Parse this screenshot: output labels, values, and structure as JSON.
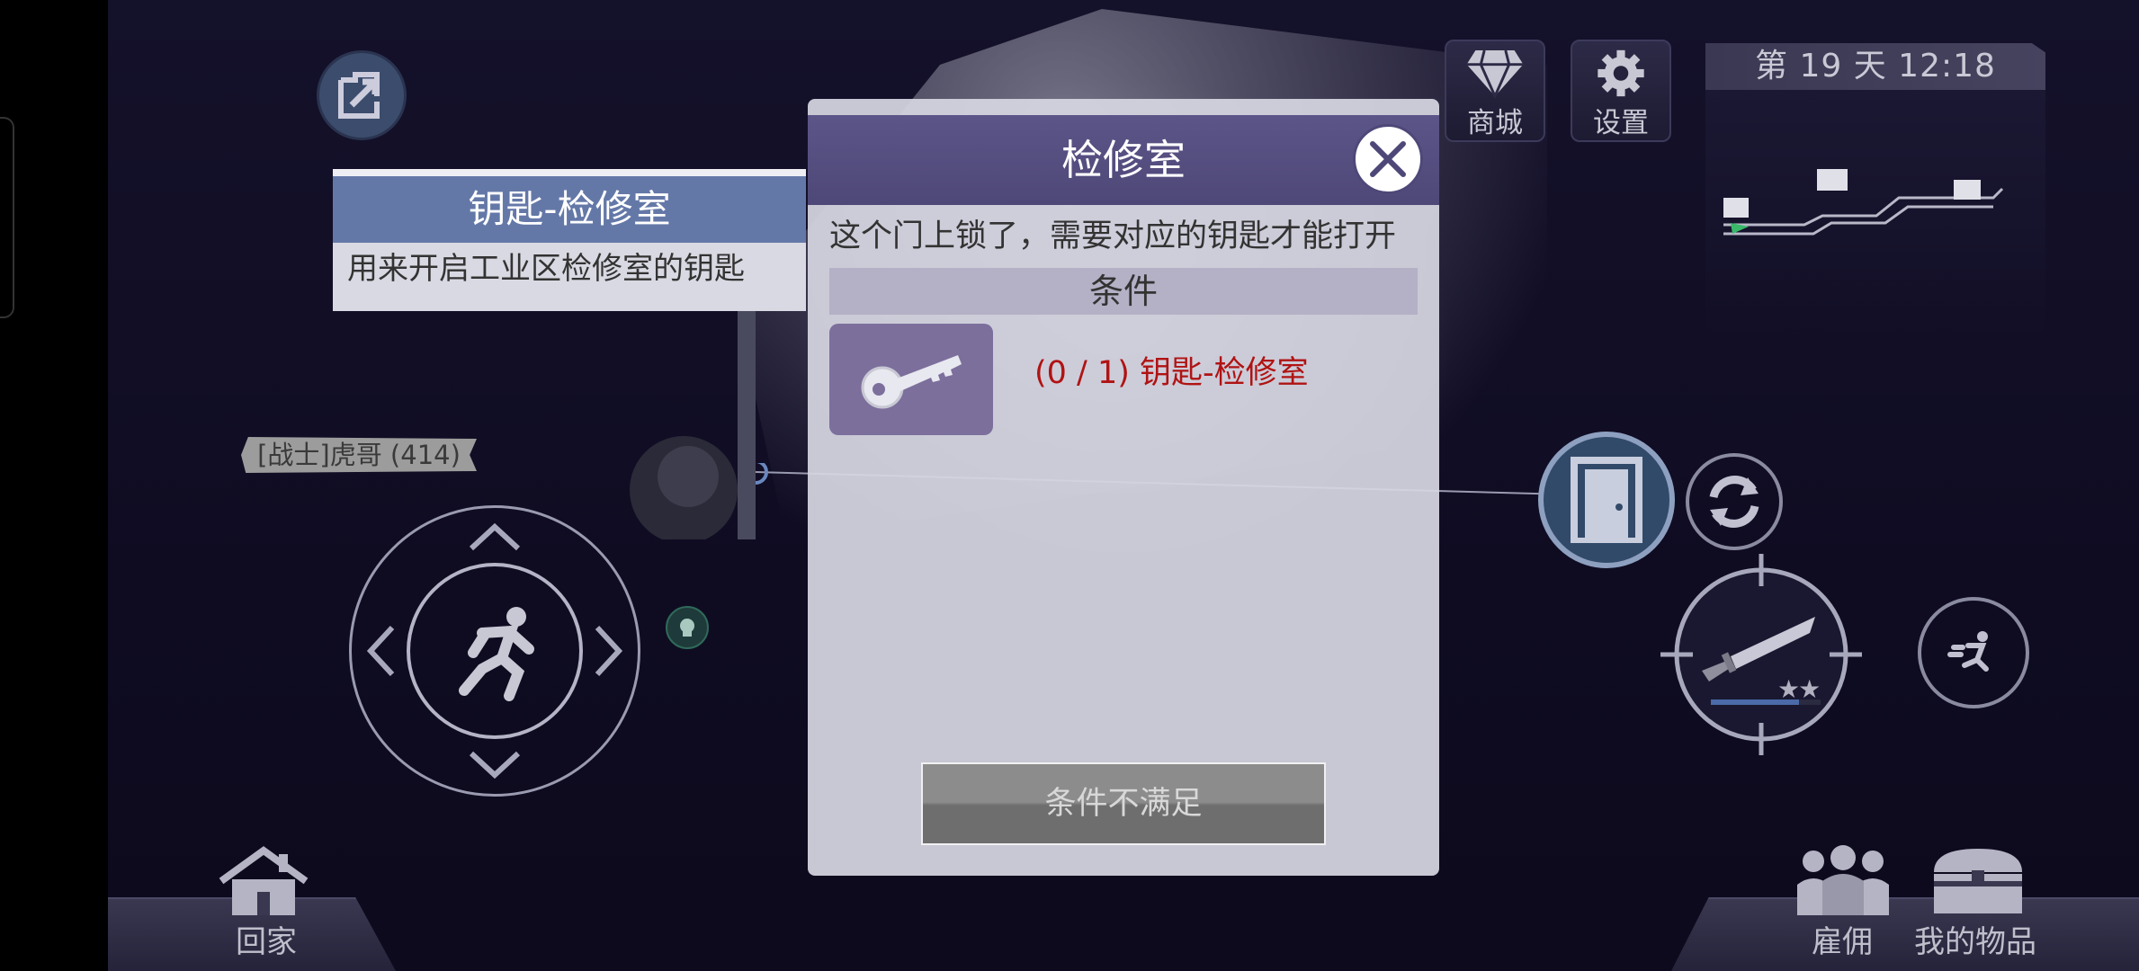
{
  "hud": {
    "day_time": "第 19 天  12:18",
    "shop_label": "商城",
    "settings_label": "设置",
    "home_label": "回家",
    "hire_label": "雇佣",
    "inventory_label": "我的物品",
    "player_name": "[战士]虎哥 (414)"
  },
  "tooltip": {
    "title": "钥匙-检修室",
    "description": "用来开启工业区检修室的钥匙"
  },
  "dialog": {
    "title": "检修室",
    "message": "这个门上锁了，需要对应的钥匙才能打开",
    "conditions_header": "条件",
    "condition_text": "(0 / 1) 钥匙-检修室",
    "action_label": "条件不满足"
  },
  "weapon": {
    "stars": 2,
    "durability": 0.8
  },
  "colors": {
    "dialog_header": "#5c5588",
    "tooltip_header": "#6478a8",
    "condition_unmet": "#b01313",
    "item_slot": "#7c6f9c"
  },
  "icons": {
    "exit": "exit-arrow-icon",
    "shop": "diamond-icon",
    "settings": "gear-icon",
    "door": "door-icon",
    "refresh": "refresh-icon",
    "weapon": "knife-icon",
    "sprint": "sprint-icon",
    "joystick": "running-man-icon",
    "home": "house-icon",
    "hire": "people-icon",
    "inventory": "chest-icon",
    "key": "key-icon",
    "close": "close-icon"
  }
}
